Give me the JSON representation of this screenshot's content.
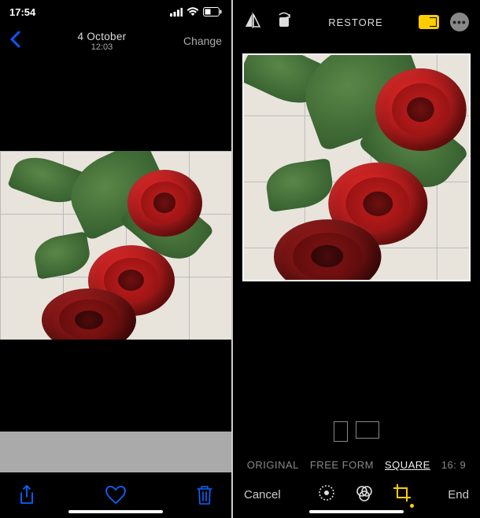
{
  "status": {
    "time": "17:54"
  },
  "left": {
    "title_date": "4 October",
    "title_time": "12:03",
    "change": "Change"
  },
  "right": {
    "restore": "RESTORE",
    "aspect": {
      "original": "ORIGINAL",
      "freeform": "FREE FORM",
      "square": "SQUARE",
      "sixteen_nine": "16: 9"
    },
    "cancel": "Cancel",
    "end": "End"
  }
}
